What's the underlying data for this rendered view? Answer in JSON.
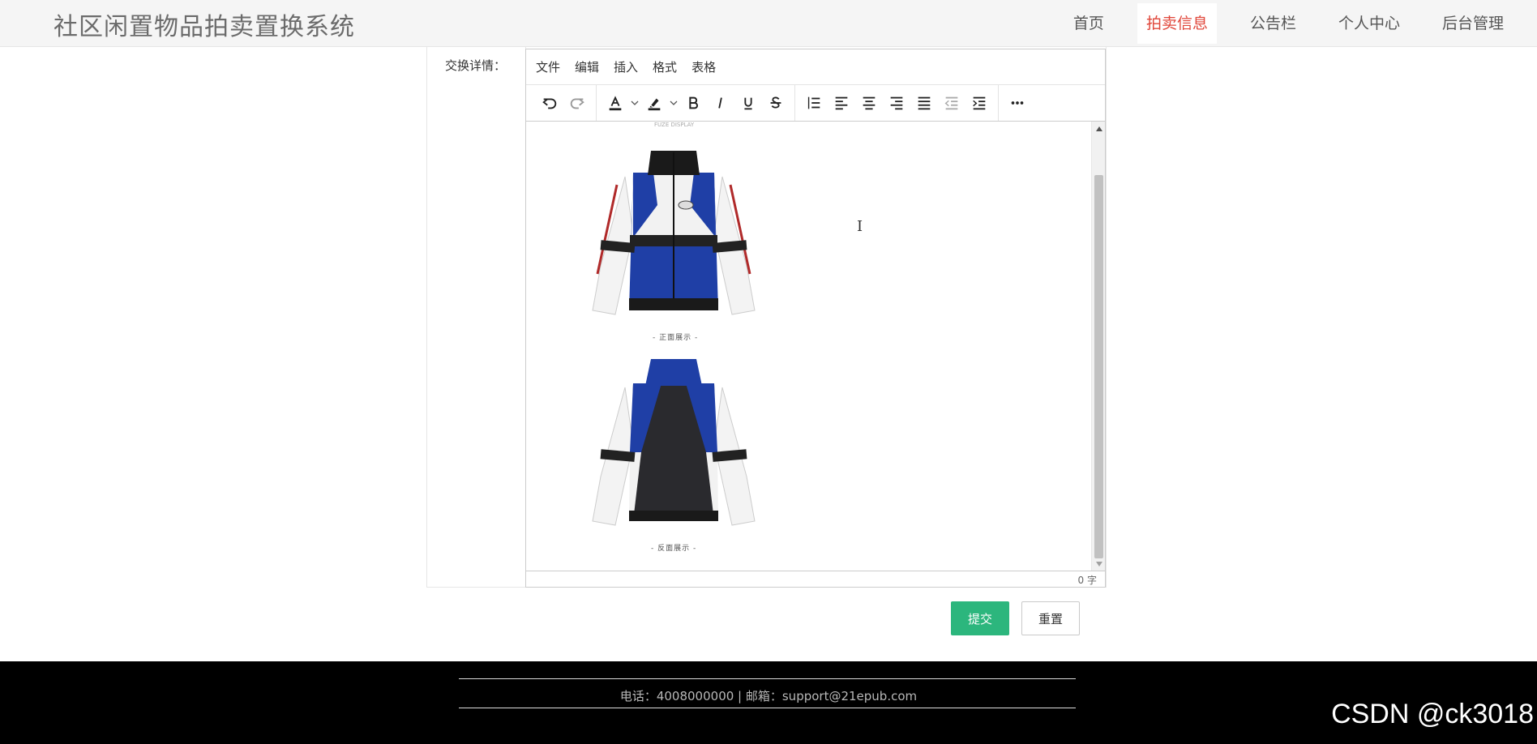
{
  "header": {
    "site_title": "社区闲置物品拍卖置换系统",
    "nav": [
      {
        "label": "首页",
        "active": false
      },
      {
        "label": "拍卖信息",
        "active": true
      },
      {
        "label": "公告栏",
        "active": false
      },
      {
        "label": "个人中心",
        "active": false
      },
      {
        "label": "后台管理",
        "active": false
      }
    ],
    "accent_color": "#e0463a"
  },
  "form": {
    "field_label": "交换详情："
  },
  "editor": {
    "menubar": [
      "文件",
      "编辑",
      "插入",
      "格式",
      "表格"
    ],
    "toolbar_icons": [
      "undo-icon",
      "redo-icon",
      "font-color-icon",
      "highlight-icon",
      "bold-icon",
      "italic-icon",
      "underline-icon",
      "strikethrough-icon",
      "line-height-icon",
      "align-left-icon",
      "align-center-icon",
      "align-right-icon",
      "align-justify-icon",
      "outdent-icon",
      "indent-icon",
      "more-icon"
    ],
    "image_top_caption": "FUZE DISPLAY",
    "front_caption": "- 正面展示 -",
    "back_caption": "- 反面展示 -",
    "word_count": "0 字"
  },
  "buttons": {
    "submit": "提交",
    "reset": "重置",
    "submit_color": "#2cb67d"
  },
  "footer": {
    "contact": "电话：4008000000 | 邮箱：support@21epub.com",
    "watermark": "CSDN @ck3018"
  }
}
